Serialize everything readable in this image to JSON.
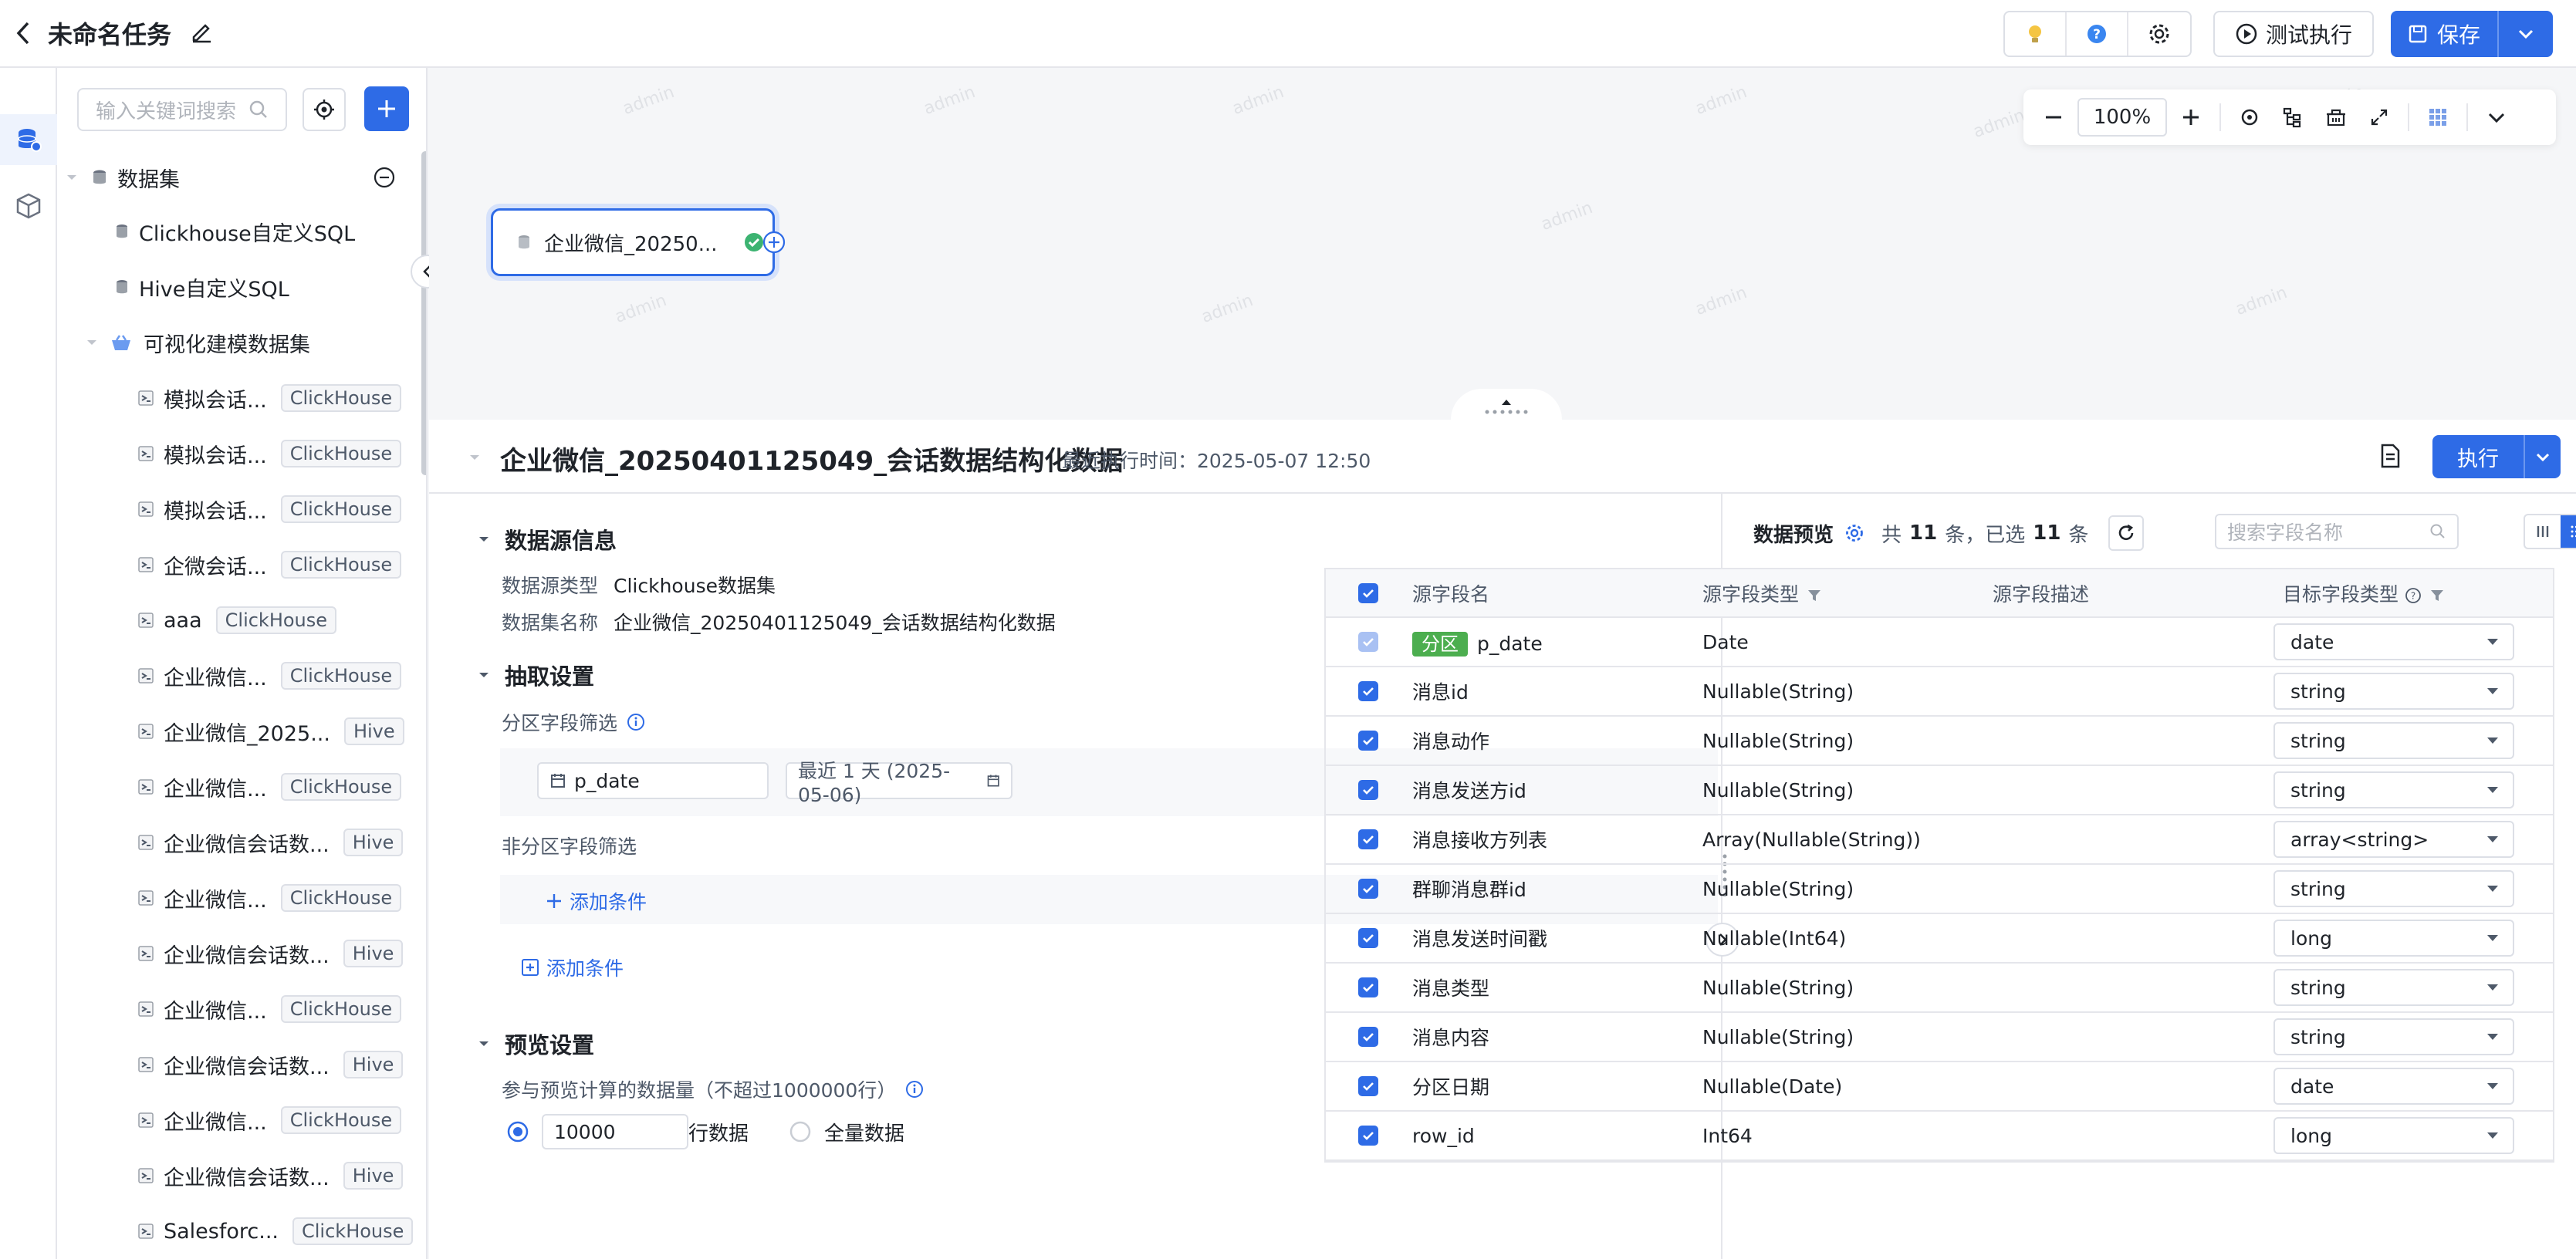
{
  "header": {
    "title": "未命名任务",
    "test_run_label": "测试执行",
    "save_label": "保存"
  },
  "sidebar": {
    "search_placeholder": "输入关键词搜索",
    "root_label": "数据集",
    "items": [
      {
        "label": "Clickhouse自定义SQL",
        "tag": ""
      },
      {
        "label": "Hive自定义SQL",
        "tag": ""
      }
    ],
    "group_label": "可视化建模数据集",
    "datasets": [
      {
        "label": "模拟会话...",
        "tag": "ClickHouse"
      },
      {
        "label": "模拟会话...",
        "tag": "ClickHouse"
      },
      {
        "label": "模拟会话...",
        "tag": "ClickHouse"
      },
      {
        "label": "企微会话...",
        "tag": "ClickHouse"
      },
      {
        "label": "aaa",
        "tag": "ClickHouse"
      },
      {
        "label": "企业微信...",
        "tag": "ClickHouse"
      },
      {
        "label": "企业微信_2025...",
        "tag": "Hive"
      },
      {
        "label": "企业微信...",
        "tag": "ClickHouse"
      },
      {
        "label": "企业微信会话数...",
        "tag": "Hive"
      },
      {
        "label": "企业微信...",
        "tag": "ClickHouse"
      },
      {
        "label": "企业微信会话数...",
        "tag": "Hive"
      },
      {
        "label": "企业微信...",
        "tag": "ClickHouse"
      },
      {
        "label": "企业微信会话数...",
        "tag": "Hive"
      },
      {
        "label": "企业微信...",
        "tag": "ClickHouse"
      },
      {
        "label": "企业微信会话数...",
        "tag": "Hive"
      },
      {
        "label": "Salesforc...",
        "tag": "ClickHouse"
      }
    ]
  },
  "canvas": {
    "zoom": "100%",
    "node_label": "企业微信_20250...",
    "watermark": "admin"
  },
  "detail": {
    "title": "企业微信_20250401125049_会话数据结构化数据",
    "last_exec": "最近执行时间：2025-05-07 12:50",
    "exec_label": "执行",
    "source_section": "数据源信息",
    "source_type_label": "数据源类型",
    "source_type_value": "Clickhouse数据集",
    "dataset_name_label": "数据集名称",
    "dataset_name_value": "企业微信_20250401125049_会话数据结构化数据",
    "extract_section": "抽取设置",
    "partition_filter_label": "分区字段筛选",
    "partition_field": "p_date",
    "partition_range": "最近 1 天 (2025-05-06)",
    "non_partition_filter_label": "非分区字段筛选",
    "add_condition_inner": "添加条件",
    "add_condition_outer": "添加条件",
    "preview_section": "预览设置",
    "preview_count_label": "参与预览计算的数据量（不超过1000000行）",
    "preview_rows_value": "10000",
    "preview_rows_unit": "行数据",
    "preview_all_label": "全量数据"
  },
  "preview": {
    "title": "数据预览",
    "summary_prefix": "共",
    "total": "11",
    "summary_mid": "条，已选",
    "selected": "11",
    "summary_suffix": "条",
    "search_placeholder": "搜索字段名称",
    "columns": [
      "源字段名",
      "源字段类型",
      "源字段描述",
      "目标字段类型"
    ],
    "partition_badge": "分区",
    "rows": [
      {
        "name": "p_date",
        "type": "Date",
        "desc": "",
        "target": "date",
        "partition": true
      },
      {
        "name": "消息id",
        "type": "Nullable(String)",
        "desc": "",
        "target": "string",
        "partition": false
      },
      {
        "name": "消息动作",
        "type": "Nullable(String)",
        "desc": "",
        "target": "string",
        "partition": false
      },
      {
        "name": "消息发送方id",
        "type": "Nullable(String)",
        "desc": "",
        "target": "string",
        "partition": false
      },
      {
        "name": "消息接收方列表",
        "type": "Array(Nullable(String))",
        "desc": "",
        "target": "array<string>",
        "partition": false
      },
      {
        "name": "群聊消息群id",
        "type": "Nullable(String)",
        "desc": "",
        "target": "string",
        "partition": false
      },
      {
        "name": "消息发送时间戳",
        "type": "Nullable(Int64)",
        "desc": "",
        "target": "long",
        "partition": false
      },
      {
        "name": "消息类型",
        "type": "Nullable(String)",
        "desc": "",
        "target": "string",
        "partition": false
      },
      {
        "name": "消息内容",
        "type": "Nullable(String)",
        "desc": "",
        "target": "string",
        "partition": false
      },
      {
        "name": "分区日期",
        "type": "Nullable(Date)",
        "desc": "",
        "target": "date",
        "partition": false
      },
      {
        "name": "row_id",
        "type": "Int64",
        "desc": "",
        "target": "long",
        "partition": false
      }
    ]
  }
}
